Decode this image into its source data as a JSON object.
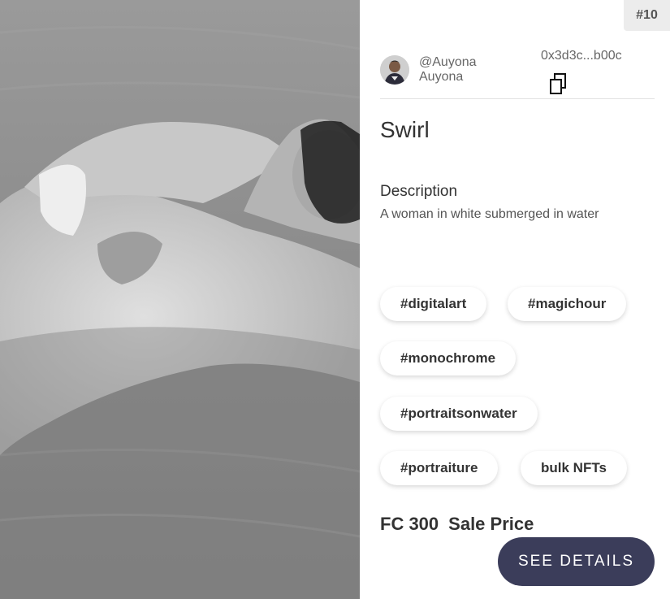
{
  "badge": "#10",
  "creator": {
    "handle": "@Auyona",
    "name": "Auyona"
  },
  "address": "0x3d3c...b00c",
  "title": "Swirl",
  "description": {
    "label": "Description",
    "text": "A woman in white submerged in water"
  },
  "tags": [
    "#digitalart",
    "#magichour",
    "#monochrome",
    "#portraitsonwater",
    "#portraiture",
    "bulk NFTs"
  ],
  "price": {
    "amount": "FC 300",
    "label": "Sale Price"
  },
  "cta_label": "SEE DETAILS",
  "colors": {
    "button": "#3b3d5a",
    "badge_bg": "#ececec"
  }
}
